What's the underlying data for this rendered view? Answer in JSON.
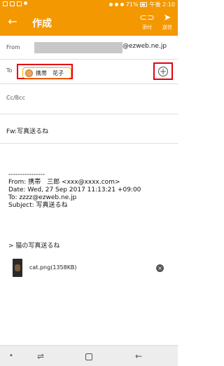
{
  "status_bar": {
    "battery": "71%",
    "time": "午後 2:10"
  },
  "app_bar": {
    "back_icon": "arrow-left-icon",
    "title": "作成",
    "attach_label": "添付",
    "send_label": "送信"
  },
  "from": {
    "label": "From",
    "domain": "@ezweb.ne.jp"
  },
  "to": {
    "label": "To",
    "recipient": "携帯　花子",
    "add_icon": "plus-circle-icon"
  },
  "cc": {
    "label": "Cc/Bcc"
  },
  "subject": {
    "value": "Fw:写真送るね"
  },
  "body": {
    "lines": [
      "----------------",
      "From: 携帯　三郎 <xxx@xxxx.com>",
      "Date: Wed, 27 Sep 2017 11:13:21 +09:00",
      "To: zzzz@ezweb.ne.jp",
      "Subject: 写真送るね"
    ],
    "quote": "> 猫の写真送るね"
  },
  "attachment": {
    "filename": "cat.png(1358KB)"
  },
  "colors": {
    "accent": "#f39800",
    "highlight": "#e60012",
    "chip_border": "#f0b400"
  }
}
